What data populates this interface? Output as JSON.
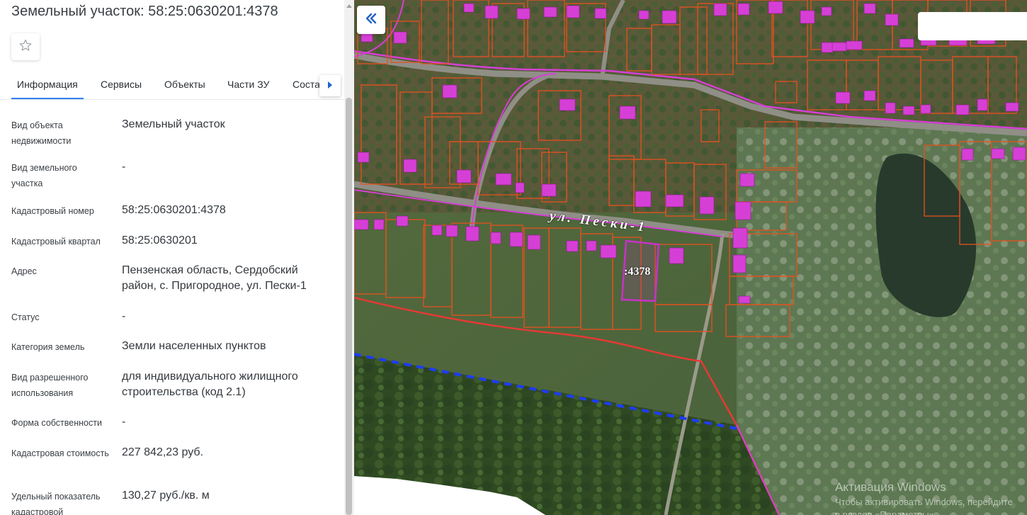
{
  "panel": {
    "title": "Земельный участок: 58:25:0630201:4378",
    "tabs": [
      {
        "label": "Информация",
        "active": true
      },
      {
        "label": "Сервисы"
      },
      {
        "label": "Объекты"
      },
      {
        "label": "Части ЗУ"
      },
      {
        "label": "Состав ЗУ"
      }
    ],
    "rows": [
      {
        "label": "Вид объекта недвижимости",
        "value": "Земельный участок"
      },
      {
        "label": "Вид земельного участка",
        "value": "-"
      },
      {
        "label": "Кадастровый номер",
        "value": "58:25:0630201:4378"
      },
      {
        "label": "Кадастровый квартал",
        "value": "58:25:0630201"
      },
      {
        "label": "Адрес",
        "value": "Пензенская область, Сердобский район, с. Пригородное, ул. Пески-1"
      },
      {
        "label": "Статус",
        "value": "-"
      },
      {
        "label": "Категория земель",
        "value": "Земли населенных пунктов"
      },
      {
        "label": "Вид разрешенного использования",
        "value": "для индивидуального жилищного строительства (код 2.1)"
      },
      {
        "label": "Форма собственности",
        "value": "-"
      },
      {
        "label": "Кадастровая стоимость",
        "value": "227 842,23 руб."
      },
      {
        "label": "Удельный показатель кадастровой",
        "value": "130,27 руб./кв. м"
      }
    ]
  },
  "map": {
    "street_label": "ул. Пески-1",
    "parcel_label": ":4378",
    "search_placeholder": ""
  },
  "watermark": {
    "title": "Активация Windows",
    "subtitle": "Чтобы активировать Windows, перейдите",
    "subtitle2": "в раздел «Параметры»"
  },
  "colors": {
    "accent": "#2f80ed",
    "parcel_border": "#e8501e",
    "building": "#d63fd6",
    "selected_parcel": "#c832c8",
    "boundary": "#e53935",
    "dashed_line": "#1e3cff"
  }
}
